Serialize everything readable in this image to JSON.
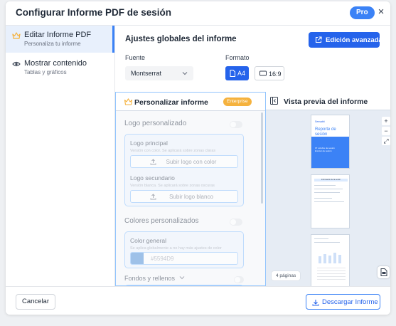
{
  "dialog": {
    "title": "Configurar Informe PDF de sesión",
    "badge": "Pro",
    "close": "×"
  },
  "sidebar": {
    "items": [
      {
        "label": "Editar Informe PDF",
        "sub": "Personaliza tu informe",
        "icon": "crown-icon",
        "active": true
      },
      {
        "label": "Mostrar contenido",
        "sub": "Tablas y gráficos",
        "icon": "eye-icon",
        "active": false
      }
    ]
  },
  "global": {
    "title": "Ajustes globales del informe",
    "advanced_button": "Edición avanzada",
    "font_label": "Fuente",
    "font_value": "Montserrat",
    "format_label": "Formato",
    "formats": [
      "A4",
      "16:9"
    ],
    "selected_format": "A4"
  },
  "customize": {
    "title": "Personalizar informe",
    "badge": "Enterprise",
    "logo": {
      "title": "Logo personalizado",
      "primary_title": "Logo principal",
      "primary_sub": "Versión con color. Se aplicará sobre zonas claras",
      "primary_button": "Subir logo con color",
      "secondary_title": "Logo secundario",
      "secondary_sub": "Versión blanca. Se aplicará sobre zonas oscuras",
      "secondary_button": "Subir logo blanco"
    },
    "colors": {
      "title": "Colores personalizados",
      "general_title": "Color general",
      "general_sub": "Se aplica globalmente a no hay más ajustes de color",
      "hex": "#5594D9",
      "swatch": "#5594D9"
    },
    "fills": {
      "title": "Fondos y rellenos"
    }
  },
  "preview": {
    "title": "Vista previa del informe",
    "cover_brand": "Sensabit",
    "cover_title": "Reporte de sesión",
    "cover_sub": "07 octubre de sesión\nEnrutar de sesión",
    "page2_heading": "Información de la sesión",
    "pages_label": "4 páginas",
    "zoom": [
      "+",
      "−",
      "⤢"
    ]
  },
  "footer": {
    "cancel": "Cancelar",
    "download": "Descargar Informe"
  },
  "colors": {
    "accent": "#2563eb",
    "enterprise": "#f5b23e",
    "pro": "#3b82f6"
  }
}
